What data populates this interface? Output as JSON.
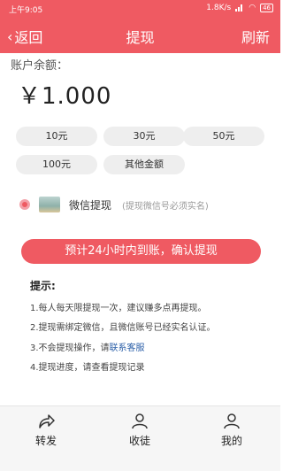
{
  "status_bar": {
    "time": "上午9:05",
    "speed": "1.8K/s",
    "battery": "46"
  },
  "nav": {
    "back_label": "返回",
    "title": "提现",
    "refresh_label": "刷新"
  },
  "balance": {
    "label": "账户余额：",
    "value": "￥1.000"
  },
  "amounts": [
    "10元",
    "30元",
    "50元",
    "100元",
    "其他金额"
  ],
  "payment": {
    "method": "微信提现",
    "hint": "(提现微信号必须实名)"
  },
  "confirm_label": "预计24小时内到账，确认提现",
  "tips": {
    "title": "提示:",
    "items": [
      "1.每人每天限提现一次，建议赚多点再提现。",
      "2.提现需绑定微信，且微信账号已经实名认证。",
      "3.不会提现操作，请",
      "4.提现进度，请查看提现记录"
    ],
    "service_link": "联系客服"
  },
  "tabs": [
    "转发",
    "收徒",
    "我的"
  ],
  "colors": {
    "accent": "#ef5a62",
    "link": "#2b5fa8"
  }
}
